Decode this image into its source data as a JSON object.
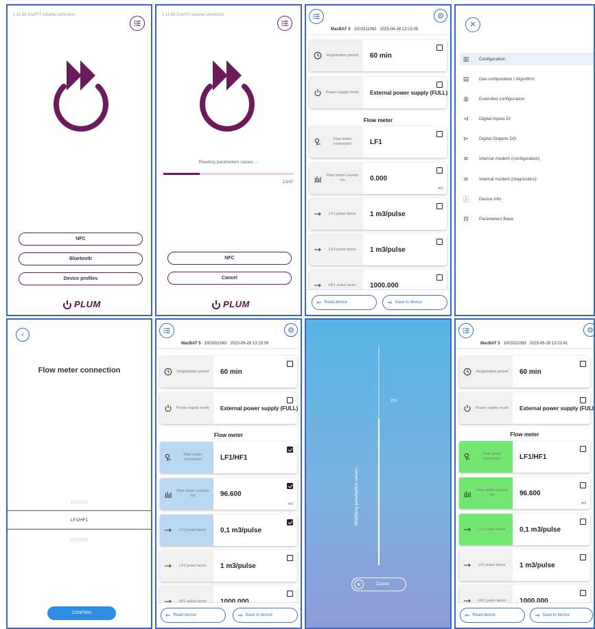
{
  "splash": {
    "version": "1.11.66 ConFIT volume correctors",
    "buttons": [
      "NFC",
      "Bluetooth",
      "Device profiles"
    ],
    "brand": "PLUM"
  },
  "reading": {
    "version": "1.11.66 ConFIT volume correctors",
    "status": "Reading parameters values ...",
    "progress_text": "13/47",
    "progress": 0.2766,
    "buttons": [
      "NFC",
      "Cancel"
    ],
    "brand": "PLUM"
  },
  "params_view": {
    "device": "MacBAT 5",
    "serial": "1003311063",
    "datetime": "2023-06-28 13:15:09",
    "section": "Flow meter",
    "rows": [
      {
        "name": "Registration period",
        "value": "60 min",
        "icon": "clock-icon"
      },
      {
        "name": "Power supply mode",
        "value": "External power supply (FULL)",
        "icon": "power-icon"
      },
      {
        "name": "Flow meter connection",
        "value": "LF1",
        "icon": "flow-connection-icon"
      },
      {
        "name": "Flow meter counter Vm",
        "value": "0.000",
        "unit": "m3",
        "icon": "bar-chart-icon"
      },
      {
        "name": "LF1 pulse factor",
        "value": "1 m3/pulse",
        "icon": "pulse-arrow-icon"
      },
      {
        "name": "LF2 pulse factor",
        "value": "1 m3/pulse",
        "icon": "pulse-arrow-icon"
      },
      {
        "name": "HF1 pulse factor",
        "value": "1000.000",
        "icon": "pulse-arrow-icon"
      }
    ],
    "read_btn": "Read device",
    "save_btn": "Save to device"
  },
  "menu": {
    "items": [
      {
        "label": "Configuration",
        "icon": "bar-chart-icon",
        "active": true
      },
      {
        "label": "Gas composition / Algorithm",
        "icon": "document-icon"
      },
      {
        "label": "Extended configuration",
        "icon": "globe-icon"
      },
      {
        "label": "Digital Inputs DI",
        "icon": "arrow-left-circle-icon"
      },
      {
        "label": "Digital Outputs DO",
        "icon": "arrow-right-circle-icon"
      },
      {
        "label": "Internal modem (configuration)",
        "icon": "wifi-icon"
      },
      {
        "label": "Internal modem (diagnostics)",
        "icon": "wifi-icon"
      },
      {
        "label": "Device info",
        "icon": "info-icon"
      },
      {
        "label": "Parameters Base",
        "icon": "database-icon"
      }
    ]
  },
  "picker": {
    "title": "Flow meter connection",
    "options": [
      "LF1/LF2",
      "LF1/HF1",
      "LF1/SCR"
    ],
    "selected": "LF1/HF1",
    "confirm": "CONFIRM"
  },
  "edit_view": {
    "device": "MacBAT 5",
    "serial": "1003311063",
    "datetime": "2023-06-28 13:15:09",
    "section": "Flow meter",
    "rows": [
      {
        "name": "Registration period",
        "value": "60 min",
        "checked": false
      },
      {
        "name": "Power supply mode",
        "value": "External power supply (FULL)",
        "checked": false
      },
      {
        "name": "Flow meter connection",
        "value": "LF1/HF1",
        "checked": true
      },
      {
        "name": "Flow meter counter Vm",
        "value": "96.600",
        "unit": "m3",
        "checked": true
      },
      {
        "name": "LF1 pulse factor",
        "value": "0,1 m3/pulse",
        "checked": true
      },
      {
        "name": "LF2 pulse factor",
        "value": "1 m3/pulse",
        "checked": false
      },
      {
        "name": "HF1 pulse factor",
        "value": "1000.000",
        "checked": false
      }
    ],
    "read_btn": "Read device",
    "save_btn": "Save to device"
  },
  "modifying": {
    "status": "Modifying parameters values...",
    "step": "2/3",
    "progress": 0.6667,
    "cancel": "Cancel"
  },
  "saved_view": {
    "device": "MacBAT 5",
    "serial": "1003311063",
    "datetime": "2023-06-28 13:22:41",
    "section": "Flow meter",
    "rows": [
      {
        "name": "Registration period",
        "value": "60 min"
      },
      {
        "name": "Power supply mode",
        "value": "External power supply (FULL)"
      },
      {
        "name": "Flow meter connection",
        "value": "LF1/HF1"
      },
      {
        "name": "Flow meter counter Vm",
        "value": "96.600",
        "unit": "m3"
      },
      {
        "name": "LF1 pulse factor",
        "value": "0,1 m3/pulse"
      },
      {
        "name": "LF2 pulse factor",
        "value": "1 m3/pulse"
      },
      {
        "name": "HF1 pulse factor",
        "value": "1000.000"
      }
    ],
    "read_btn": "Read device",
    "save_btn": "Save to device"
  },
  "colors": {
    "brand_purple": "#6b1a5a",
    "accent_blue": "#3a6fc0",
    "selected_row": "#b9d9f2",
    "saved_row": "#72e872",
    "confirm_button": "#2f8de4"
  }
}
